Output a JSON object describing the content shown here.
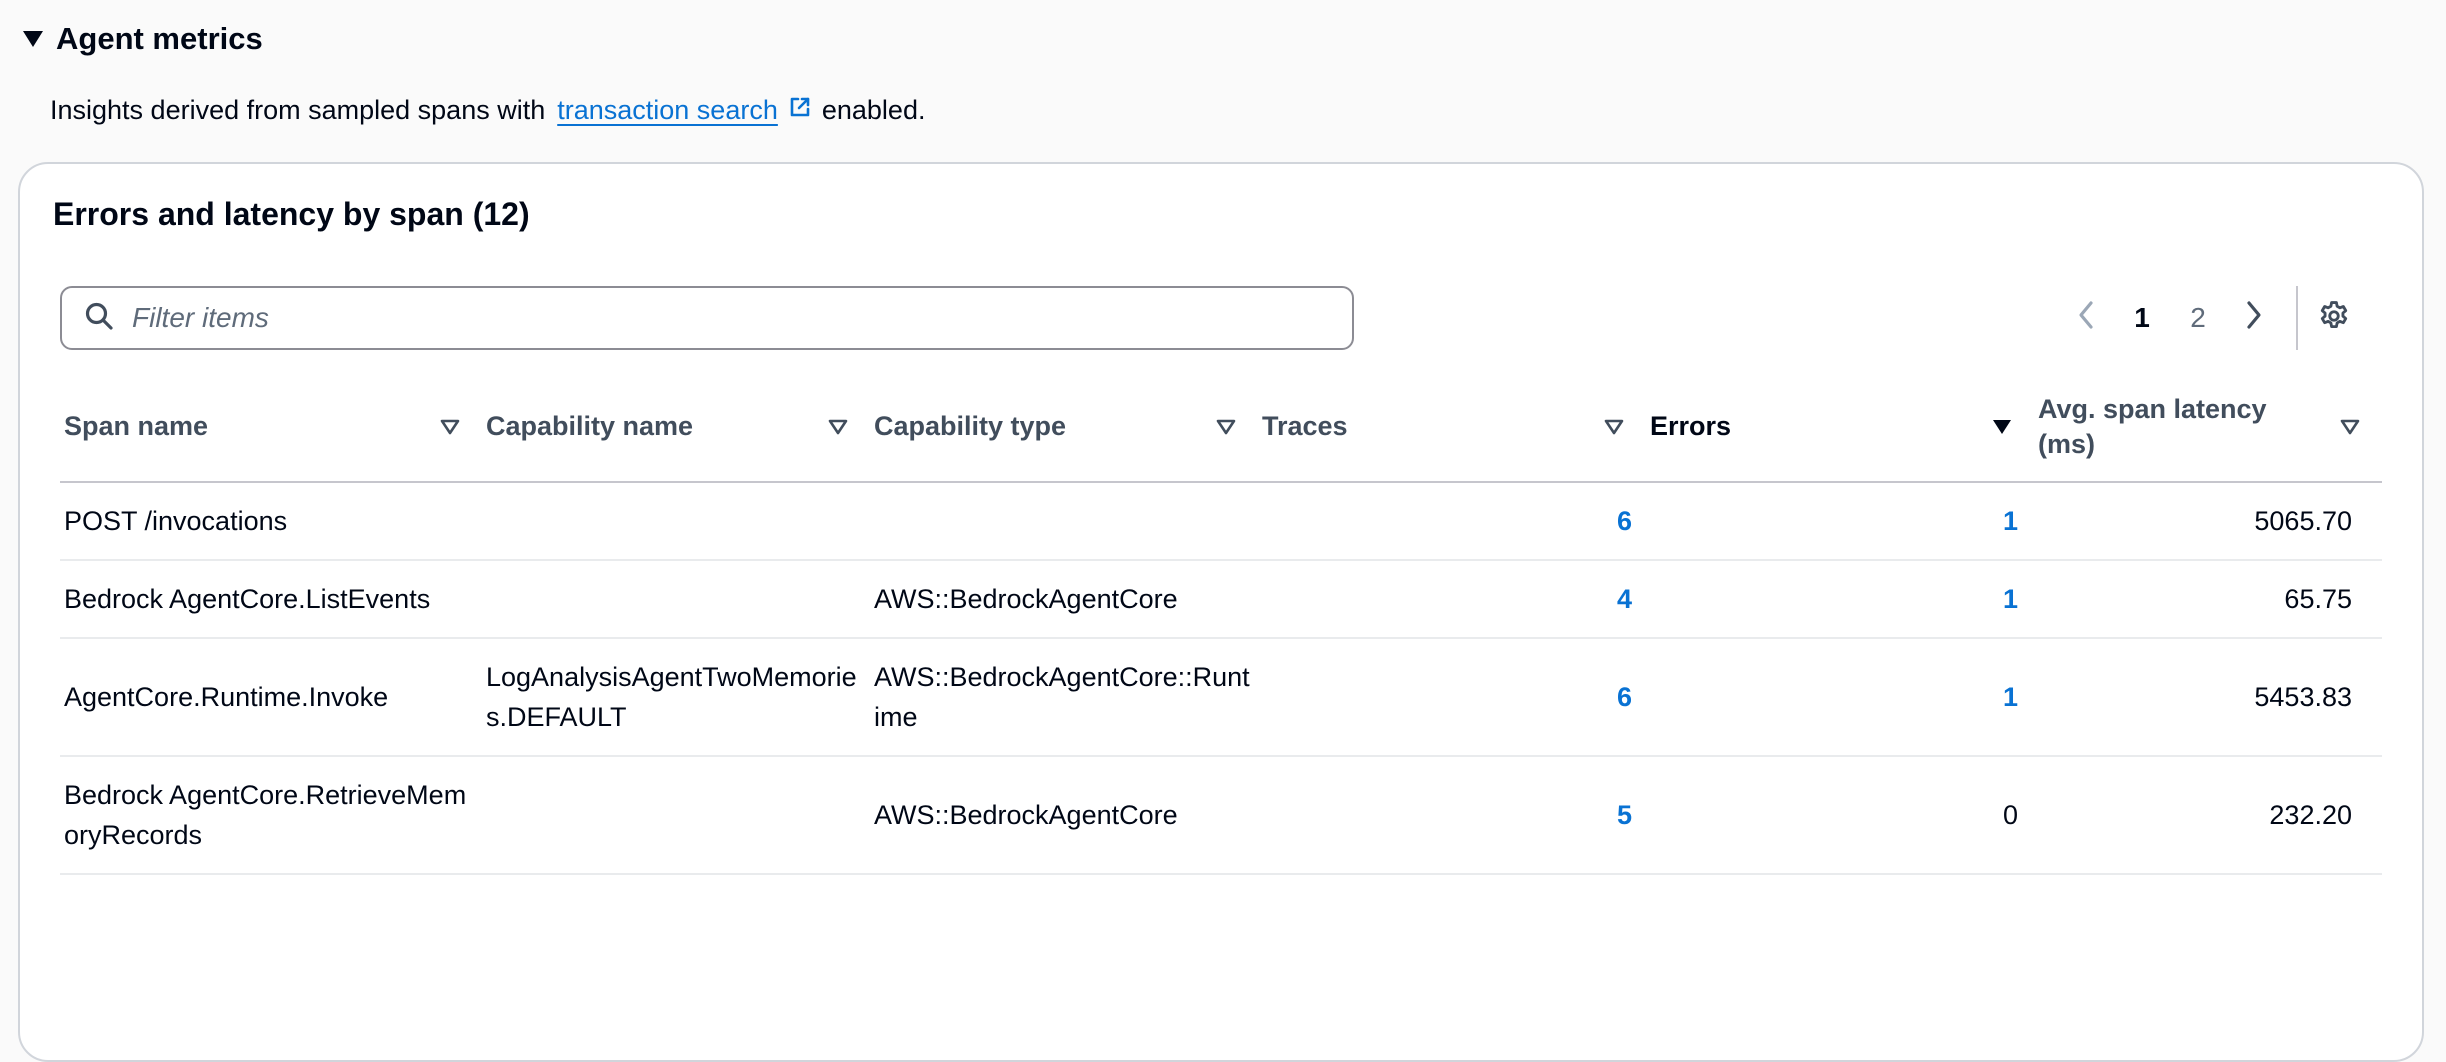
{
  "section": {
    "title": "Agent metrics"
  },
  "insights": {
    "prefix": "Insights derived from sampled spans with",
    "link": "transaction search",
    "suffix": "enabled."
  },
  "panel": {
    "title": "Errors and latency by span (12)"
  },
  "filter": {
    "placeholder": "Filter items",
    "value": ""
  },
  "pagination": {
    "pages": [
      "1",
      "2"
    ],
    "current": "1"
  },
  "columns": [
    {
      "label": "Span name"
    },
    {
      "label": "Capability name"
    },
    {
      "label": "Capability type"
    },
    {
      "label": "Traces"
    },
    {
      "label": "Errors",
      "sorted": true
    },
    {
      "label": "Avg. span latency (ms)"
    }
  ],
  "rows": [
    {
      "span": "POST /invocations",
      "cap_name": "",
      "cap_type": "",
      "traces": "6",
      "errors": "1",
      "latency": "5065.70"
    },
    {
      "span": "Bedrock AgentCore.ListEvents",
      "cap_name": "",
      "cap_type": "AWS::BedrockAgentCore",
      "traces": "4",
      "errors": "1",
      "latency": "65.75"
    },
    {
      "span": "AgentCore.Runtime.Invoke",
      "cap_name": "LogAnalysisAgentTwoMemories.DEFAULT",
      "cap_type": "AWS::BedrockAgentCore::Runtime",
      "traces": "6",
      "errors": "1",
      "latency": "5453.83"
    },
    {
      "span": "Bedrock AgentCore.RetrieveMemoryRecords",
      "cap_name": "",
      "cap_type": "AWS::BedrockAgentCore",
      "traces": "5",
      "errors": "0",
      "latency": "232.20"
    }
  ],
  "colors": {
    "link": "#0972d3",
    "text": "#000716",
    "muted": "#5f6b7a"
  }
}
